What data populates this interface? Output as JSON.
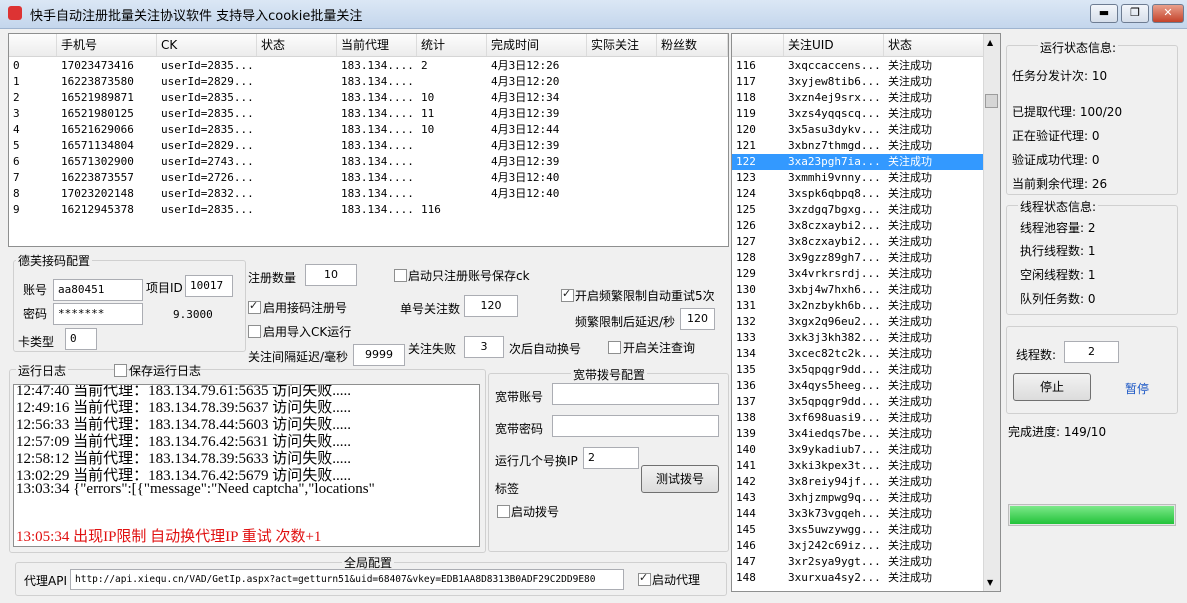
{
  "window": {
    "title": "快手自动注册批量关注协议软件 支持导入cookie批量关注",
    "min": "▬",
    "max": "❐",
    "close": "✕"
  },
  "accounts_table": {
    "columns": [
      "",
      "手机号",
      "CK",
      "状态",
      "当前代理",
      "统计",
      "完成时间",
      "实际关注",
      "粉丝数"
    ],
    "rows": [
      [
        "0",
        "17023473416",
        "userId=2835...",
        "",
        "183.134....",
        "2",
        "4月3日12:26",
        "",
        ""
      ],
      [
        "1",
        "16223873580",
        "userId=2829...",
        "",
        "183.134....",
        "",
        "4月3日12:20",
        "",
        ""
      ],
      [
        "2",
        "16521989871",
        "userId=2835...",
        "",
        "183.134....",
        "10",
        "4月3日12:34",
        "",
        ""
      ],
      [
        "3",
        "16521980125",
        "userId=2835...",
        "",
        "183.134....",
        "11",
        "4月3日12:39",
        "",
        ""
      ],
      [
        "4",
        "16521629066",
        "userId=2835...",
        "",
        "183.134....",
        "10",
        "4月3日12:44",
        "",
        ""
      ],
      [
        "5",
        "16571134804",
        "userId=2829...",
        "",
        "183.134....",
        "",
        "4月3日12:39",
        "",
        ""
      ],
      [
        "6",
        "16571302900",
        "userId=2743...",
        "",
        "183.134....",
        "",
        "4月3日12:39",
        "",
        ""
      ],
      [
        "7",
        "16223873557",
        "userId=2726...",
        "",
        "183.134....",
        "",
        "4月3日12:40",
        "",
        ""
      ],
      [
        "8",
        "17023202148",
        "userId=2832...",
        "",
        "183.134....",
        "",
        "4月3日12:40",
        "",
        ""
      ],
      [
        "9",
        "16212945378",
        "userId=2835...",
        "",
        "183.134....",
        "116",
        "",
        "",
        ""
      ]
    ]
  },
  "follow_table": {
    "columns": [
      "",
      "关注UID",
      "状态"
    ],
    "selected_index": 6,
    "rows": [
      [
        "116",
        "3xqccaccens...",
        "关注成功"
      ],
      [
        "117",
        "3xyjew8tib6...",
        "关注成功"
      ],
      [
        "118",
        "3xzn4ej9srx...",
        "关注成功"
      ],
      [
        "119",
        "3xzs4yqqscq...",
        "关注成功"
      ],
      [
        "120",
        "3x5asu3dykv...",
        "关注成功"
      ],
      [
        "121",
        "3xbnz7thmgd...",
        "关注成功"
      ],
      [
        "122",
        "3xa23pgh7ia...",
        "关注成功"
      ],
      [
        "123",
        "3xmmhi9vnny...",
        "关注成功"
      ],
      [
        "124",
        "3xspk6qbpq8...",
        "关注成功"
      ],
      [
        "125",
        "3xzdgq7bgxg...",
        "关注成功"
      ],
      [
        "126",
        "3x8czxaybi2...",
        "关注成功"
      ],
      [
        "127",
        "3x8czxaybi2...",
        "关注成功"
      ],
      [
        "128",
        "3x9gzz89gh7...",
        "关注成功"
      ],
      [
        "129",
        "3x4vrkrsrdj...",
        "关注成功"
      ],
      [
        "130",
        "3xbj4w7hxh6...",
        "关注成功"
      ],
      [
        "131",
        "3x2nzbykh6b...",
        "关注成功"
      ],
      [
        "132",
        "3xgx2q96eu2...",
        "关注成功"
      ],
      [
        "133",
        "3xk3j3kh382...",
        "关注成功"
      ],
      [
        "134",
        "3xcec82tc2k...",
        "关注成功"
      ],
      [
        "135",
        "3x5qpqgr9dd...",
        "关注成功"
      ],
      [
        "136",
        "3x4qys5heeg...",
        "关注成功"
      ],
      [
        "137",
        "3x5qpqgr9dd...",
        "关注成功"
      ],
      [
        "138",
        "3xf698uasi9...",
        "关注成功"
      ],
      [
        "139",
        "3x4iedqs7be...",
        "关注成功"
      ],
      [
        "140",
        "3x9ykadiub7...",
        "关注成功"
      ],
      [
        "141",
        "3xki3kpex3t...",
        "关注成功"
      ],
      [
        "142",
        "3x8reiy94jf...",
        "关注成功"
      ],
      [
        "143",
        "3xhjzmpwg9q...",
        "关注成功"
      ],
      [
        "144",
        "3x3k73vgqeh...",
        "关注成功"
      ],
      [
        "145",
        "3xs5uwzywgg...",
        "关注成功"
      ],
      [
        "146",
        "3xj242c69iz...",
        "关注成功"
      ],
      [
        "147",
        "3xr2sya9ygt...",
        "关注成功"
      ],
      [
        "148",
        "3xurxua4sy2...",
        "关注成功"
      ]
    ]
  },
  "sms_config": {
    "title": "德芙接码配置",
    "account_label": "账号",
    "account_value": "aa80451",
    "password_label": "密码",
    "password_value": "*******",
    "project_id_label": "项目ID",
    "project_id_value": "10017",
    "balance": "9.3000",
    "card_type_label": "卡类型",
    "card_type_value": "0"
  },
  "options": {
    "register_count_label": "注册数量",
    "register_count_value": "10",
    "only_register_label": "启动只注册账号保存ck",
    "enable_sms_label": "启用接码注册号",
    "single_follow_label": "单号关注数",
    "single_follow_value": "120",
    "retry_label": "开启频繁限制自动重试5次",
    "import_ck_label": "启用导入CK运行",
    "delay_after_limit_label": "频繁限制后延迟/秒",
    "delay_after_limit_value": "120",
    "interval_label": "关注间隔延迟/毫秒",
    "interval_value": "9999",
    "fail_label": "关注失败",
    "fail_value": "3",
    "fail_suffix": "次后自动换号",
    "query_label": "开启关注查询"
  },
  "log": {
    "title": "运行日志",
    "save_label": "保存运行日志",
    "lines": [
      "12:47:40 当前代理：183.134.79.61:5635  访问失败.....",
      "12:49:16 当前代理：183.134.78.39:5637  访问失败.....",
      "12:56:33 当前代理：183.134.78.44:5603  访问失败.....",
      "12:57:09 当前代理：183.134.76.42:5631  访问失败.....",
      "12:58:12 当前代理：183.134.78.39:5633  访问失败.....",
      "13:02:29 当前代理：183.134.76.42:5679  访问失败.....",
      "13:03:34 {\"errors\":[{\"message\":\"Need captcha\",\"locations\""
    ],
    "alert": "13:05:34 出现IP限制 自动换代理IP 重试 次数+1"
  },
  "broadband": {
    "title": "宽带拨号配置",
    "account_label": "宽带账号",
    "password_label": "宽带密码",
    "switch_label": "运行几个号换IP",
    "switch_value": "2",
    "test_button": "测试拨号",
    "tag_label": "标签",
    "auto_dial_label": "启动拨号"
  },
  "global": {
    "title": "全局配置",
    "proxy_label": "代理API",
    "proxy_value": "http://api.xiequ.cn/VAD/GetIp.aspx?act=getturn51&uid=68407&vkey=EDB1AA8D8313B0ADF29C2DD9E80",
    "enable_proxy_label": "启动代理"
  },
  "status": {
    "run_title": "运行状态信息:",
    "tasks": "任务分发计次: 10",
    "fetched_proxy": "已提取代理: 100/20",
    "verifying": "正在验证代理: 0",
    "verified": "验证成功代理: 0",
    "remaining": "当前剩余代理: 26",
    "thread_title": "线程状态信息:",
    "pool": "线程池容量: 2",
    "executing": "执行线程数: 1",
    "idle": "空闲线程数: 1",
    "queue": "队列任务数: 0",
    "thread_count_label": "线程数:",
    "thread_count_value": "2",
    "stop_button": "停止",
    "pause_link": "暂停",
    "progress_text": "完成进度: 149/10",
    "progress_fraction": 1.0,
    "progress_color": "#22c33a"
  }
}
